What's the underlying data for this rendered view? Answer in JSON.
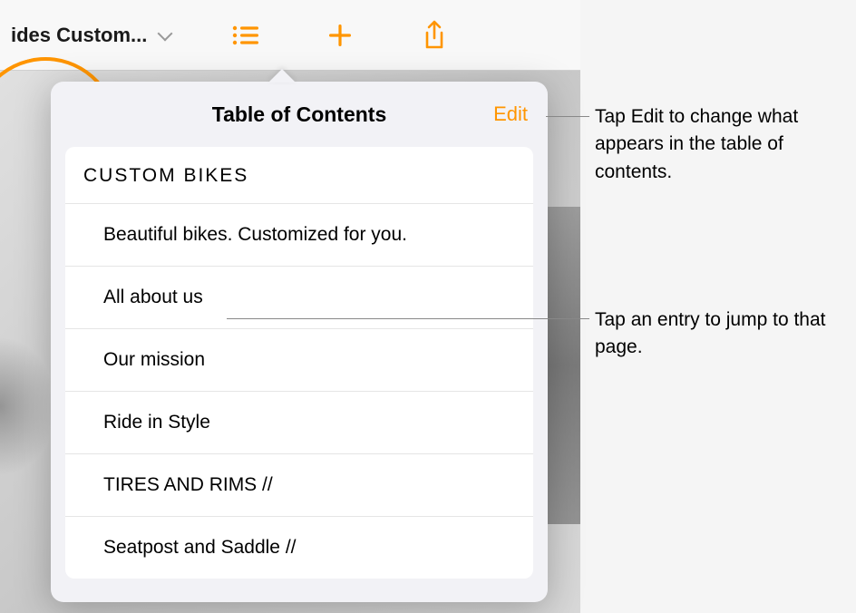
{
  "toolbar": {
    "doc_title": "ides Custom..."
  },
  "popover": {
    "title": "Table of Contents",
    "edit_label": "Edit",
    "heading": "CUSTOM  BIKES",
    "items": [
      "Beautiful bikes. Customized for you.",
      "All about us",
      "Our mission",
      "Ride in Style",
      "TIRES AND RIMS //",
      "Seatpost and Saddle //"
    ]
  },
  "annotations": {
    "a1": "Tap Edit to change what appears in the table of contents.",
    "a2": "Tap an entry to jump to that page."
  }
}
